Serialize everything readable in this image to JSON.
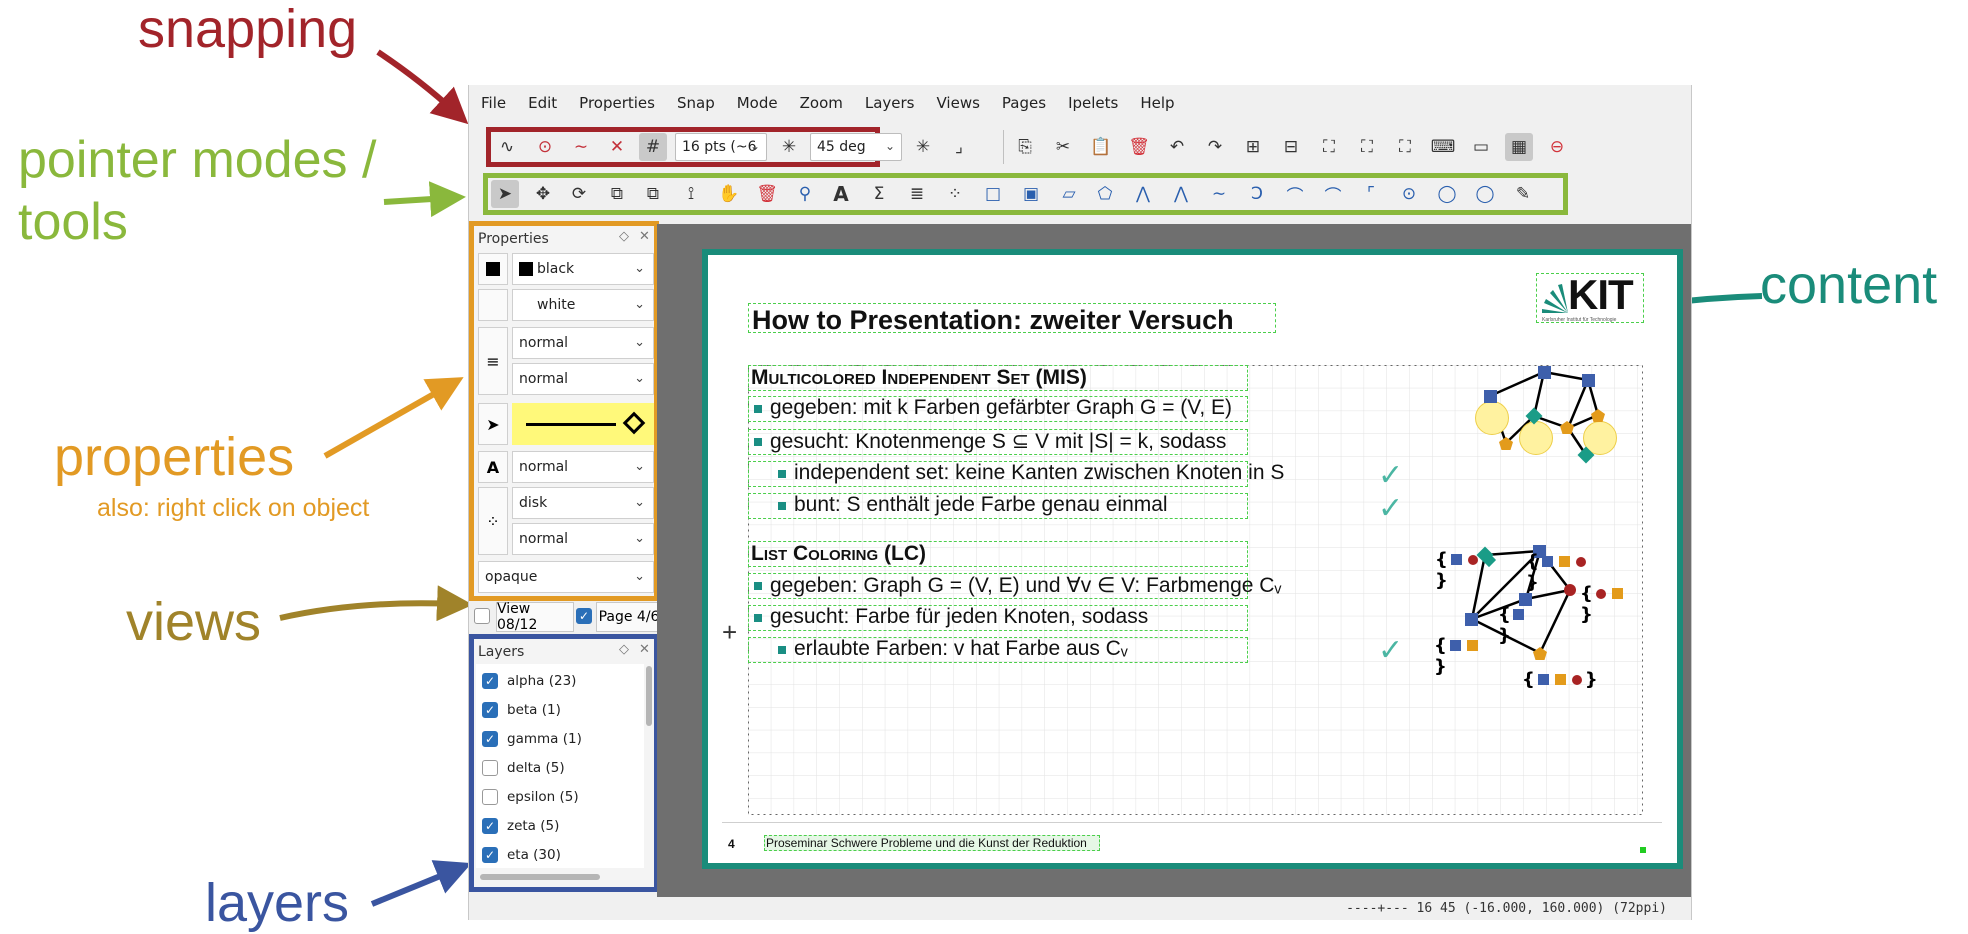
{
  "annotations": {
    "snapping": "snapping",
    "pointer_modes": "pointer modes /",
    "tools": "tools",
    "content": "content",
    "properties": "properties",
    "properties_sub": "also: right click on object",
    "views": "views",
    "layers": "layers",
    "colors": {
      "snapping": "#a2242a",
      "pointer": "#8ab83c",
      "content": "#1a8c7a",
      "properties": "#e29a24",
      "views": "#a0832a",
      "layers": "#3a55a0"
    }
  },
  "menubar": [
    "File",
    "Edit",
    "Properties",
    "Snap",
    "Mode",
    "Zoom",
    "Layers",
    "Views",
    "Pages",
    "Ipelets",
    "Help"
  ],
  "snap_toolbar": {
    "grid_size": "16 pts (~6",
    "angle": "45 deg"
  },
  "properties_panel": {
    "title": "Properties",
    "stroke": "black",
    "fill": "white",
    "pen": "normal",
    "dash": "normal",
    "text_size": "normal",
    "symbol": "disk",
    "symbol_size": "normal",
    "opacity": "opaque"
  },
  "views_bar": {
    "view": "View 08/12",
    "page": "Page 4/6"
  },
  "layers_panel": {
    "title": "Layers",
    "items": [
      {
        "label": "alpha (23)",
        "checked": true
      },
      {
        "label": "beta (1)",
        "checked": true
      },
      {
        "label": "gamma (1)",
        "checked": true
      },
      {
        "label": "delta (5)",
        "checked": false
      },
      {
        "label": "epsilon (5)",
        "checked": false
      },
      {
        "label": "zeta (5)",
        "checked": true
      },
      {
        "label": "eta (30)",
        "checked": true
      }
    ]
  },
  "slide": {
    "title": "How to Presentation: zweiter Versuch",
    "section1": "Multicolored Independent Set (MIS)",
    "s1_given": "gegeben: mit k Farben gefärbter Graph G = (V, E)",
    "s1_sought": "gesucht: Knotenmenge S ⊆ V mit |S| = k, sodass",
    "s1_sub1": "independent set: keine Kanten zwischen Knoten in S",
    "s1_sub2": "bunt: S enthält jede Farbe genau einmal",
    "section2": "List Coloring (LC)",
    "s2_given": "gegeben: Graph G = (V, E) und ∀v ∈ V: Farbmenge Cᵥ",
    "s2_sought": "gesucht: Farbe für jeden Knoten, sodass",
    "s2_sub1": "erlaubte Farben: v hat Farbe aus Cᵥ",
    "logo": "KIT",
    "logo_sub": "Karlsruher Institut für Technologie",
    "footer_num": "4",
    "footer_text": "Proseminar Schwere Probleme und die Kunst der Reduktion"
  },
  "statusbar": "----+--- 16 45 (-16.000, 160.000) (72ppi)"
}
